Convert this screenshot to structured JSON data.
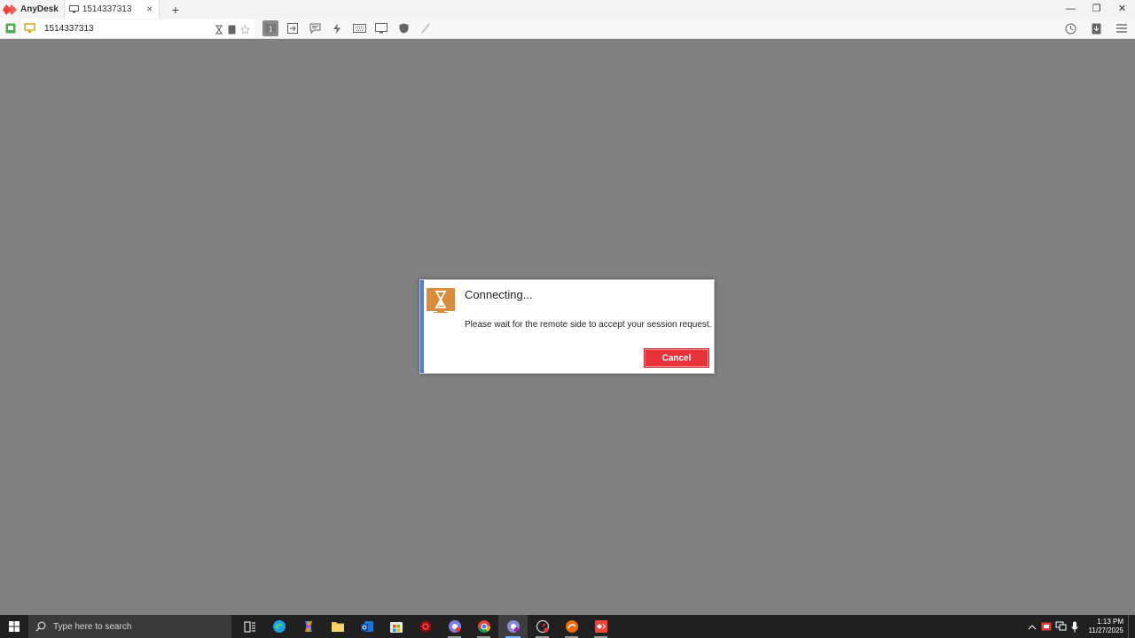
{
  "app": {
    "name": "AnyDesk",
    "brand_color": "#ef443b"
  },
  "tab": {
    "label": "1514337313"
  },
  "address_bar": {
    "value": "1514337313"
  },
  "dialog": {
    "title": "Connecting...",
    "message": "Please wait for the remote side to accept your session request.",
    "cancel_label": "Cancel",
    "icon": "hourglass-monitor-icon",
    "accent_color": "#4f7fd0",
    "button_color": "#e8333a"
  },
  "taskbar": {
    "search_placeholder": "Type here to search",
    "apps": [
      "task-view",
      "edge",
      "copilot",
      "file-explorer",
      "outlook",
      "microsoft-store",
      "video-app",
      "chrome-profile",
      "chrome",
      "chrome-profile-2",
      "speedometer-app",
      "orange-app",
      "anydesk"
    ],
    "clock_time": "1:13 PM",
    "clock_date": "11/27/2025"
  }
}
